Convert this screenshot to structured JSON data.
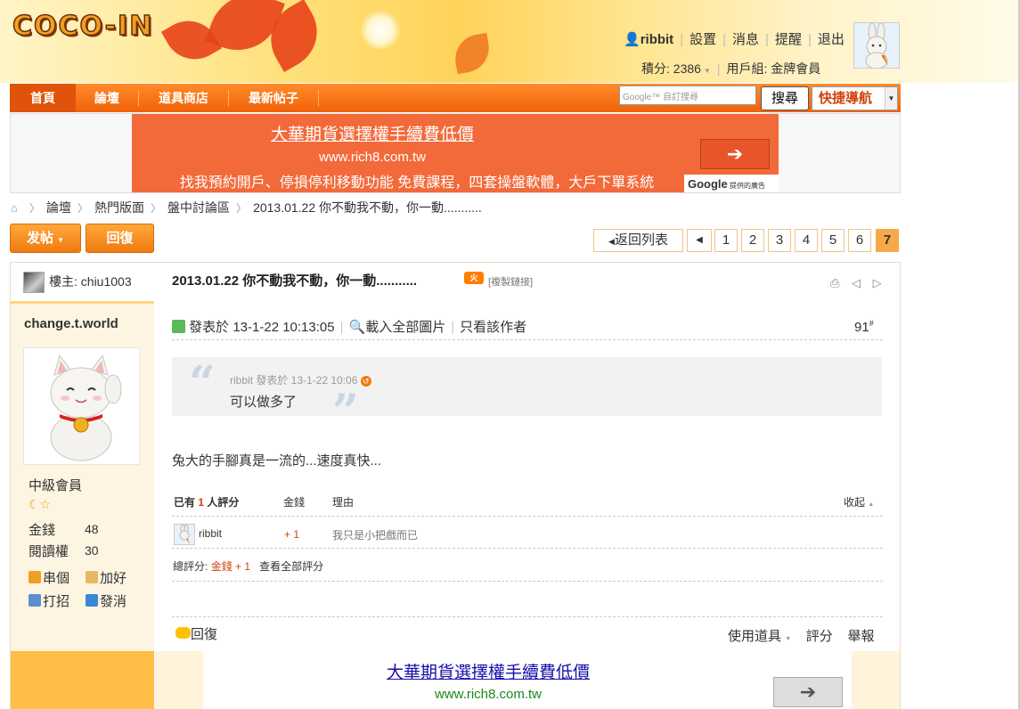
{
  "header": {
    "logo_text": "COCO-IN",
    "username": "ribbit",
    "menu": [
      "設置",
      "消息",
      "提醒",
      "退出"
    ],
    "points_label": "積分: 2386",
    "usergroup_label": "用戶組: 金牌會員"
  },
  "nav": {
    "items": [
      "首頁",
      "論壇",
      "道具商店",
      "最新帖子"
    ],
    "search_placeholder": "Google™ 自訂搜尋",
    "search_button": "搜尋",
    "quick_nav": "快捷導航"
  },
  "ad_top": {
    "title": "大華期貨選擇權手續費低價",
    "url": "www.rich8.com.tw",
    "description": "找我預約開戶、停損停利移動功能 免費課程，四套操盤軟體，大戶下單系統",
    "arrow": "➔",
    "google_label": "Google",
    "google_sub": "提供的廣告"
  },
  "breadcrumb": [
    "論壇",
    "熱門版面",
    "盤中討論區",
    "2013.01.22 你不動我不動，你一動..........."
  ],
  "actions": {
    "post_button": "发帖",
    "reply_button": "回復",
    "back_to_list": "返回列表",
    "prev": "◀",
    "pages": [
      "1",
      "2",
      "3",
      "4",
      "5",
      "6",
      "7"
    ],
    "current_page": "7"
  },
  "sidebar": {
    "owner_label": "樓主: chiu1003",
    "author": "change.t.world",
    "rank": "中級會員",
    "rank_icons": "☾☆",
    "stats": [
      {
        "label": "金錢",
        "value": "48"
      },
      {
        "label": "閱讀權",
        "value": "30"
      }
    ],
    "links": [
      "串個",
      "加好",
      "打招",
      "發消"
    ]
  },
  "post": {
    "title": "2013.01.22 你不動我不動，你一動...........",
    "fire_badge": "火",
    "copy_link": "[複製鏈接]",
    "tool_icons": "⎙ ◁ ▷",
    "meta_posted": "發表於 13-1-22 10:13:05",
    "meta_load_images": "載入全部圖片",
    "meta_author_only": "只看該作者",
    "floor": "91",
    "floor_sup": "#",
    "quote": {
      "author_line": "ribbit 發表於 13-1-22 10:06",
      "text": "可以做多了",
      "open_mark": "“",
      "close_mark": "”"
    },
    "body": "兔大的手腳真是一流的...速度真快...",
    "rating": {
      "count_prefix": "已有",
      "count": "1",
      "count_suffix": "人評分",
      "col_money": "金錢",
      "col_reason": "理由",
      "collapse": "收起",
      "rows": [
        {
          "user": "ribbit",
          "money": "+ 1",
          "reason": "我只是小把戲而已"
        }
      ],
      "total_label": "總評分:",
      "total_value": "金錢 + 1",
      "view_all": "查看全部評分"
    },
    "footer": {
      "reply": "回復",
      "use_tool": "使用道具",
      "rate": "評分",
      "report": "舉報"
    }
  },
  "ad_bottom": {
    "title": "大華期貨選擇權手續費低價",
    "url": "www.rich8.com.tw",
    "arrow": "➔"
  },
  "colors": {
    "nav_orange": "#f0620a",
    "accent_orange": "#f7a94a",
    "ad_orange": "#f36a3a",
    "link_blue": "#1a0dab"
  }
}
